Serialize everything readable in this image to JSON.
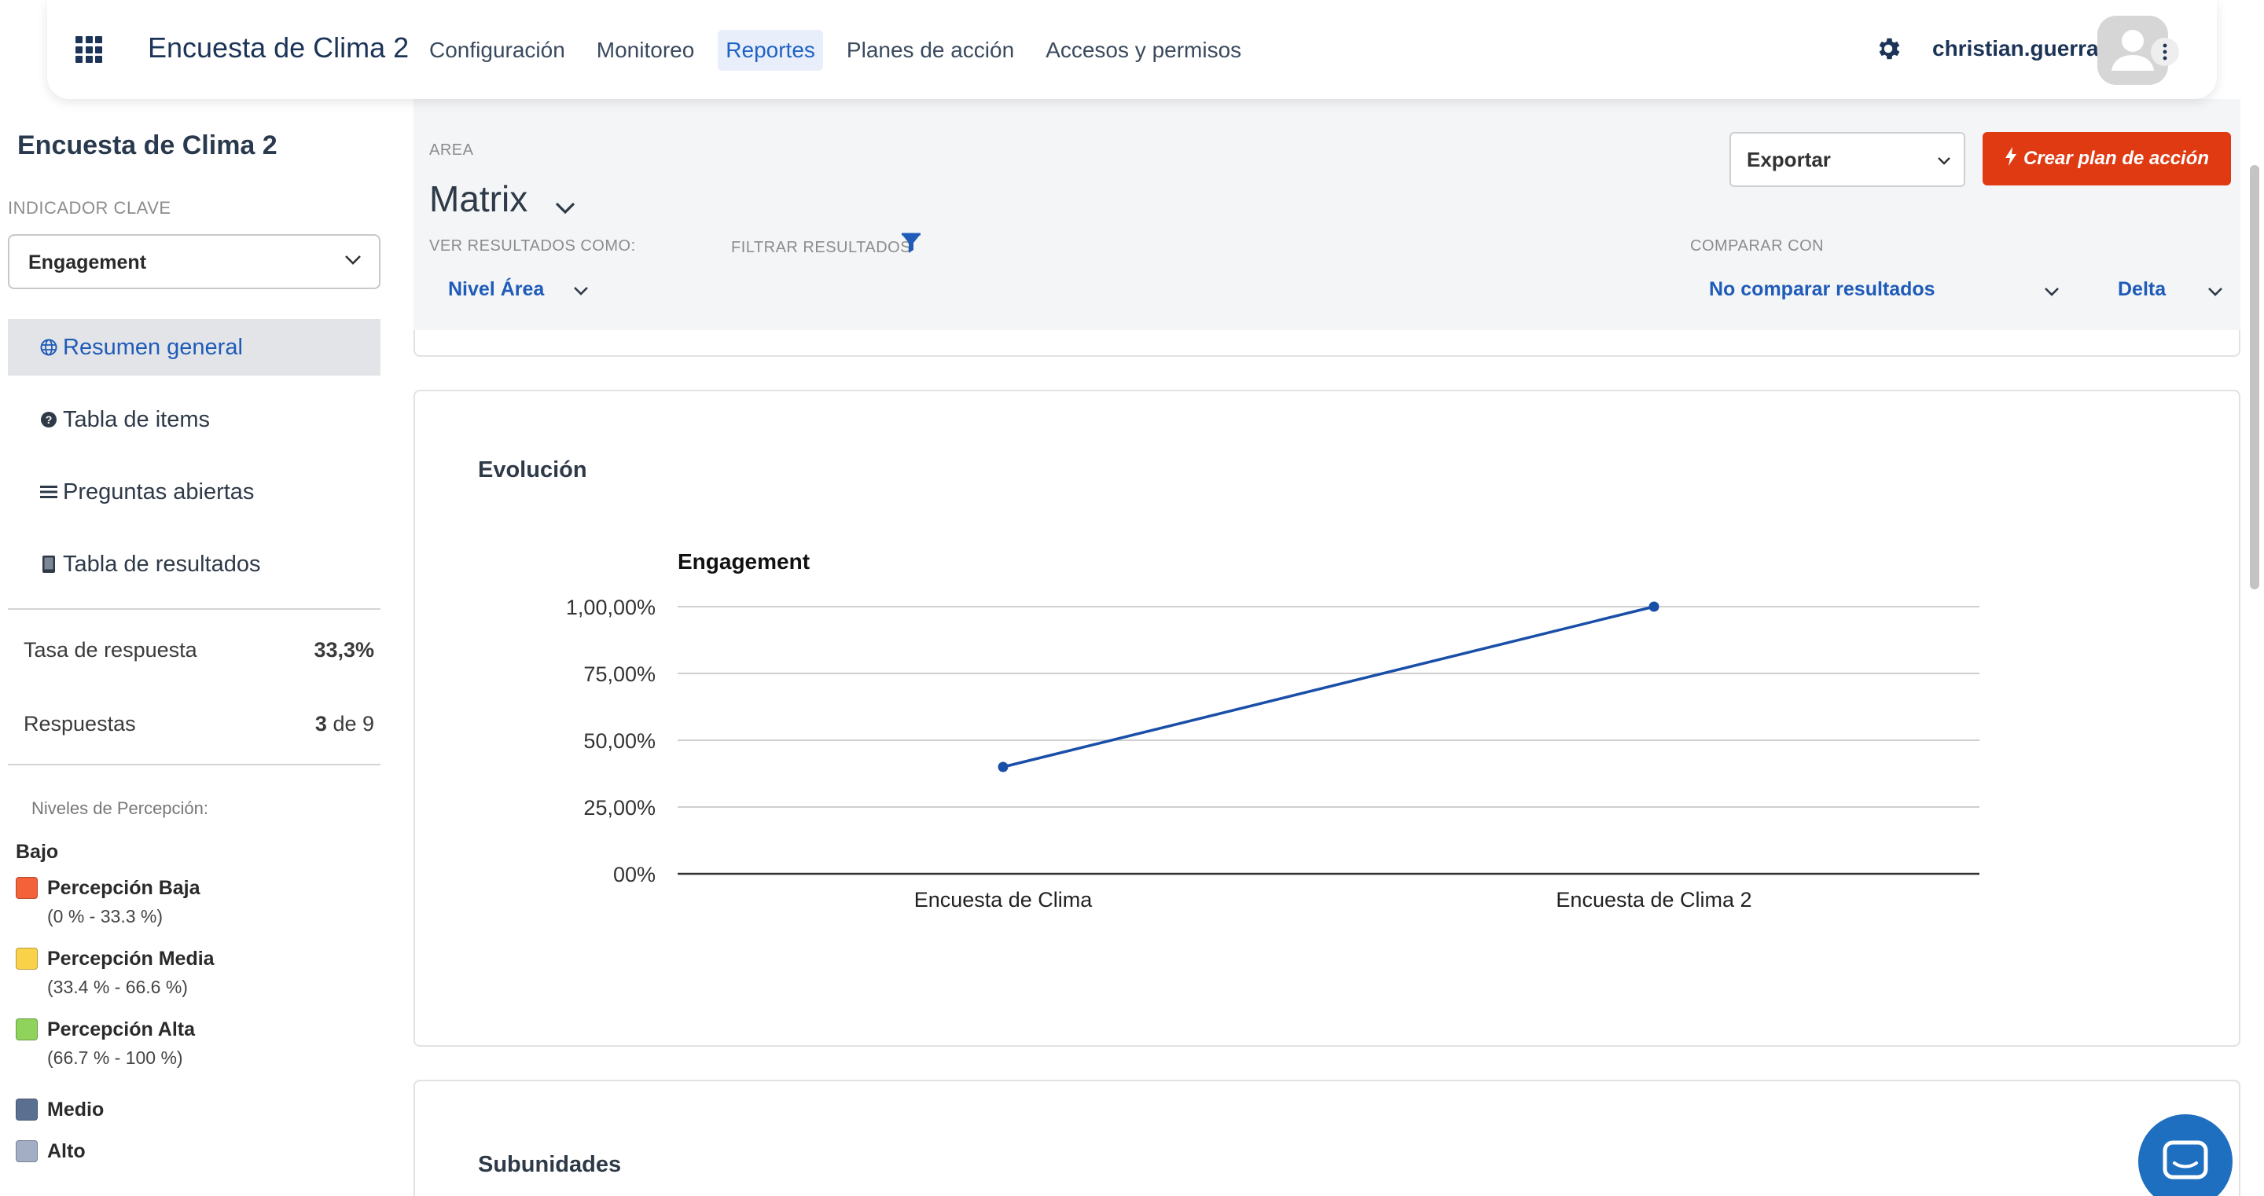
{
  "header": {
    "app_title": "Encuesta de Clima 2",
    "nav": [
      {
        "label": "Configuración",
        "active": false
      },
      {
        "label": "Monitoreo",
        "active": false
      },
      {
        "label": "Reportes",
        "active": true
      },
      {
        "label": "Planes de acción",
        "active": false
      },
      {
        "label": "Accesos y permisos",
        "active": false
      }
    ],
    "username": "christian.guerra"
  },
  "sidebar": {
    "survey_title": "Encuesta de Clima 2",
    "kpi_label": "INDICADOR CLAVE",
    "kpi_value": "Engagement",
    "menu": [
      {
        "label": "Resumen general",
        "icon": "globe-icon",
        "active": true
      },
      {
        "label": "Tabla de items",
        "icon": "help-circle-icon",
        "active": false
      },
      {
        "label": "Preguntas abiertas",
        "icon": "list-icon",
        "active": false
      },
      {
        "label": "Tabla de resultados",
        "icon": "tablet-icon",
        "active": false
      }
    ],
    "response_rate_label": "Tasa de respuesta",
    "response_rate_value": "33,3%",
    "responses_label": "Respuestas",
    "responses_count": "3",
    "responses_of": "de 9",
    "legend_title": "Niveles de Percepción:",
    "group_low": "Bajo",
    "levels": [
      {
        "label": "Percepción Baja",
        "range": "(0 % - 33.3 %)",
        "color": "#f4623a"
      },
      {
        "label": "Percepción Media",
        "range": "(33.4 % - 66.6 %)",
        "color": "#f9d24a"
      },
      {
        "label": "Percepción Alta",
        "range": "(66.7 % - 100 %)",
        "color": "#8fd25c"
      }
    ],
    "group_mid": "Medio",
    "group_mid_color": "#5b7090",
    "group_high": "Alto",
    "group_high_color": "#a3aec4"
  },
  "filters": {
    "area_label": "AREA",
    "area_value": "Matrix",
    "view_as_label": "VER RESULTADOS COMO:",
    "view_as_value": "Nivel Área",
    "filter_label": "FILTRAR RESULTADOS",
    "compare_label": "COMPARAR CON",
    "compare_value": "No comparar resultados",
    "delta_value": "Delta",
    "export_label": "Exportar",
    "create_plan_label": "Crear plan de acción"
  },
  "evolution": {
    "card_title": "Evolución"
  },
  "chart_data": {
    "type": "line",
    "title": "Engagement",
    "categories": [
      "Encuesta de Clima",
      "Encuesta de Clima 2"
    ],
    "series": [
      {
        "values": [
          40,
          100
        ]
      }
    ],
    "yticks": [
      "00%",
      "25,00%",
      "50,00%",
      "75,00%",
      "1,00,00%"
    ],
    "ylim": [
      0,
      100
    ],
    "line_color": "#1a4fa8",
    "grid": true
  },
  "subunits": {
    "card_title": "Subunidades"
  },
  "colors": {
    "accent": "#1f5bb8",
    "cta": "#e03a12"
  }
}
